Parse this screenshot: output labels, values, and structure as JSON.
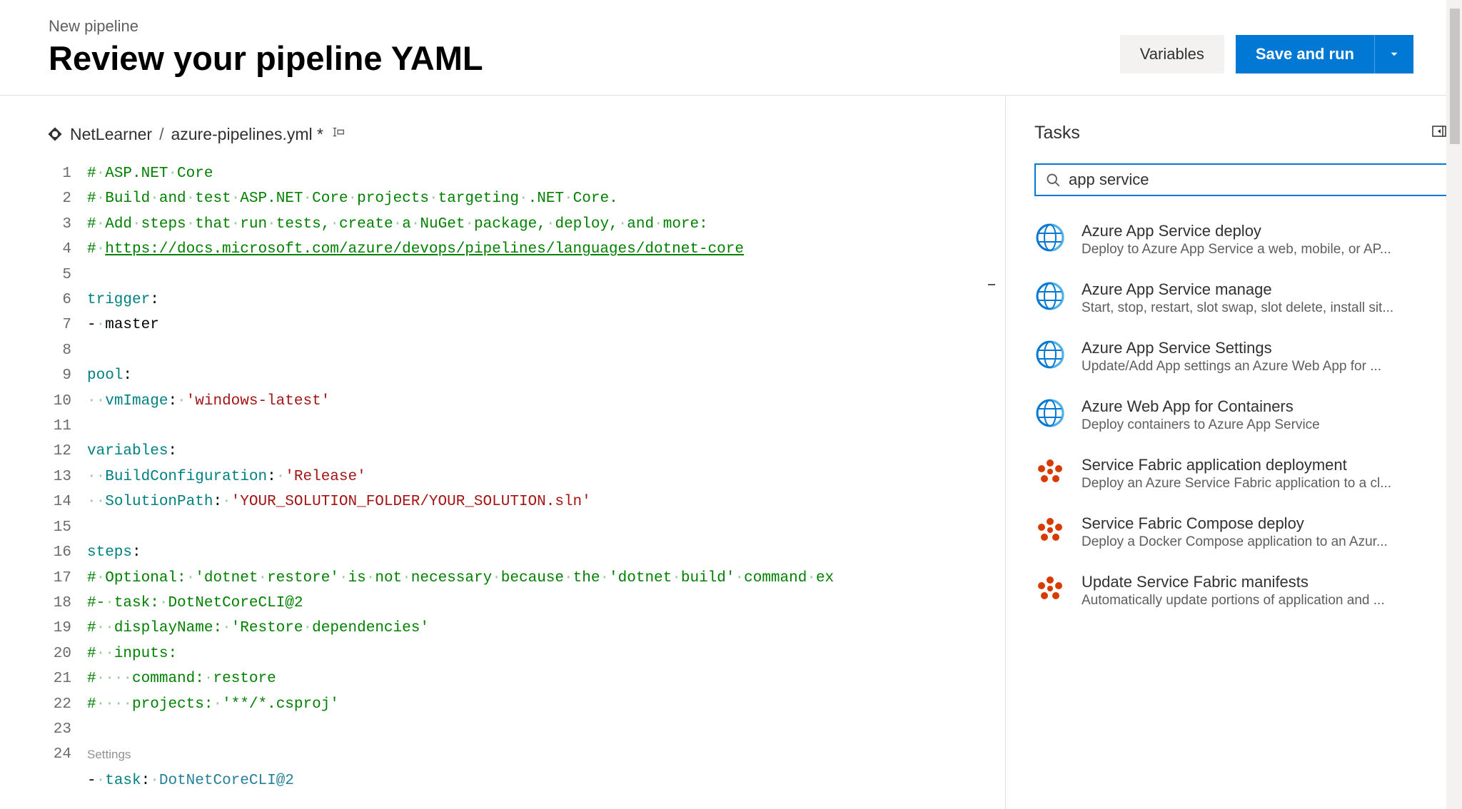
{
  "header": {
    "breadcrumb": "New pipeline",
    "title": "Review your pipeline YAML",
    "variables_label": "Variables",
    "save_label": "Save and run"
  },
  "file": {
    "repo": "NetLearner",
    "name": "azure-pipelines.yml *"
  },
  "editor": {
    "lines": [
      {
        "n": 1,
        "type": "comment",
        "text": "# ASP.NET Core"
      },
      {
        "n": 2,
        "type": "comment",
        "text": "# Build and test ASP.NET Core projects targeting .NET Core."
      },
      {
        "n": 3,
        "type": "comment",
        "text": "# Add steps that run tests, create a NuGet package, deploy, and more:"
      },
      {
        "n": 4,
        "type": "link",
        "prefix": "# ",
        "text": "https://docs.microsoft.com/azure/devops/pipelines/languages/dotnet-core"
      },
      {
        "n": 5,
        "type": "blank",
        "text": ""
      },
      {
        "n": 6,
        "type": "key",
        "key": "trigger",
        "text": ":"
      },
      {
        "n": 7,
        "type": "plain",
        "text": "- master"
      },
      {
        "n": 8,
        "type": "blank",
        "text": ""
      },
      {
        "n": 9,
        "type": "key",
        "key": "pool",
        "text": ":"
      },
      {
        "n": 10,
        "type": "kv",
        "indent": "  ",
        "key": "vmImage",
        "val": "'windows-latest'"
      },
      {
        "n": 11,
        "type": "blank",
        "text": ""
      },
      {
        "n": 12,
        "type": "key",
        "key": "variables",
        "text": ":"
      },
      {
        "n": 13,
        "type": "kv",
        "indent": "  ",
        "key": "BuildConfiguration",
        "val": "'Release'"
      },
      {
        "n": 14,
        "type": "kv",
        "indent": "  ",
        "key": "SolutionPath",
        "val": "'YOUR_SOLUTION_FOLDER/YOUR_SOLUTION.sln'"
      },
      {
        "n": 15,
        "type": "blank",
        "text": ""
      },
      {
        "n": 16,
        "type": "key",
        "key": "steps",
        "text": ":"
      },
      {
        "n": 17,
        "type": "comment",
        "text": "# Optional: 'dotnet restore' is not necessary because the 'dotnet build' command ex"
      },
      {
        "n": 18,
        "type": "comment",
        "text": "#- task: DotNetCoreCLI@2"
      },
      {
        "n": 19,
        "type": "comment",
        "text": "#  displayName: 'Restore dependencies'"
      },
      {
        "n": 20,
        "type": "comment",
        "text": "#  inputs:"
      },
      {
        "n": 21,
        "type": "comment",
        "text": "#    command: restore"
      },
      {
        "n": 22,
        "type": "comment",
        "text": "#    projects: '**/*.csproj'"
      },
      {
        "n": 23,
        "type": "blank",
        "text": ""
      }
    ],
    "codelens": "Settings",
    "partial24": {
      "n": 24,
      "prefix": "- ",
      "key": "task",
      "sep": ": ",
      "task": "DotNetCoreCLI@2"
    }
  },
  "tasks": {
    "title": "Tasks",
    "search_value": "app service",
    "items": [
      {
        "title": "Azure App Service deploy",
        "desc": "Deploy to Azure App Service a web, mobile, or AP...",
        "icon": "azure"
      },
      {
        "title": "Azure App Service manage",
        "desc": "Start, stop, restart, slot swap, slot delete, install sit...",
        "icon": "azure"
      },
      {
        "title": "Azure App Service Settings",
        "desc": "Update/Add App settings an Azure Web App for ...",
        "icon": "azure"
      },
      {
        "title": "Azure Web App for Containers",
        "desc": "Deploy containers to Azure App Service",
        "icon": "azure"
      },
      {
        "title": "Service Fabric application deployment",
        "desc": "Deploy an Azure Service Fabric application to a cl...",
        "icon": "fabric"
      },
      {
        "title": "Service Fabric Compose deploy",
        "desc": "Deploy a Docker Compose application to an Azur...",
        "icon": "fabric"
      },
      {
        "title": "Update Service Fabric manifests",
        "desc": "Automatically update portions of application and ...",
        "icon": "fabric"
      }
    ]
  }
}
